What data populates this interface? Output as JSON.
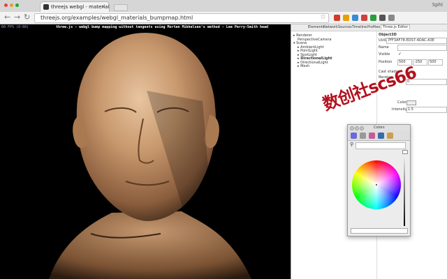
{
  "browser": {
    "tab_title": "threejs webgl - material",
    "tab_close": "×",
    "user_name": "Sphl",
    "url": "threejs.org/examples/webgl_materials_bumpmap.html",
    "back_icon": "arrow-left-icon",
    "forward_icon": "arrow-right-icon",
    "reload_icon": "reload-icon",
    "star_icon": "star-icon",
    "back_glyph": "←",
    "forward_glyph": "→",
    "reload_glyph": "↻",
    "star_glyph": "☆",
    "extension_colors": [
      "#d23a2a",
      "#e6a100",
      "#3a8ad8",
      "#d04040",
      "#2a9d3a",
      "#555555",
      "#888888"
    ]
  },
  "viewport": {
    "fps": "60 FPS (0-60)",
    "caption": "three.js - webgl bump mapping without tangents using Morten Mikkelsen's method - Lee Perry-Smith head"
  },
  "devtools": {
    "tabs": [
      "Elements",
      "Network",
      "Sources",
      "Timeline",
      "Profiles",
      "Three.js Editor"
    ],
    "active_tab": "Three.js Editor",
    "tree": [
      {
        "label": "Renderer",
        "indent": 0,
        "expander": "▸",
        "selected": false
      },
      {
        "label": "PerspectiveCamera",
        "indent": 1,
        "expander": "",
        "selected": false
      },
      {
        "label": "Scene",
        "indent": 0,
        "expander": "▾",
        "selected": false
      },
      {
        "label": "AmbientLight",
        "indent": 1,
        "expander": "▸",
        "selected": false
      },
      {
        "label": "PointLight",
        "indent": 1,
        "expander": "▸",
        "selected": false
      },
      {
        "label": "SpotLight",
        "indent": 1,
        "expander": "▸",
        "selected": false
      },
      {
        "label": "DirectionalLight",
        "indent": 1,
        "expander": "▸",
        "selected": true
      },
      {
        "label": "DirectionalLight",
        "indent": 1,
        "expander": "▸",
        "selected": false
      },
      {
        "label": "Mesh",
        "indent": 1,
        "expander": "▸",
        "selected": false
      }
    ],
    "properties": {
      "object_type": "Object3D",
      "uuid_label": "UUID",
      "uuid_value": "7FF3AF78-EDS7-4DAC-A3E",
      "name_label": "Name",
      "name_value": "",
      "visible_label": "Visible",
      "visible_mark": "✓",
      "position_label": "Position",
      "position_values": [
        "500",
        "-250",
        "500"
      ],
      "cast_shadow_label": "Cast shadow",
      "cast_shadow_mark": "✓",
      "receive_label": "Receive",
      "receive_value": "0",
      "color_label": "Color",
      "intensity_label": "Intensity",
      "intensity_value": "1.5"
    }
  },
  "watermark": "数创社scs66",
  "colors_panel": {
    "title": "Colors",
    "search_icon": "magnifier-icon",
    "search_glyph": "⚲",
    "mode_colors": [
      "#6a6ad8",
      "#999999",
      "#c85a9a",
      "#3a6aa8",
      "#c8a050"
    ]
  }
}
